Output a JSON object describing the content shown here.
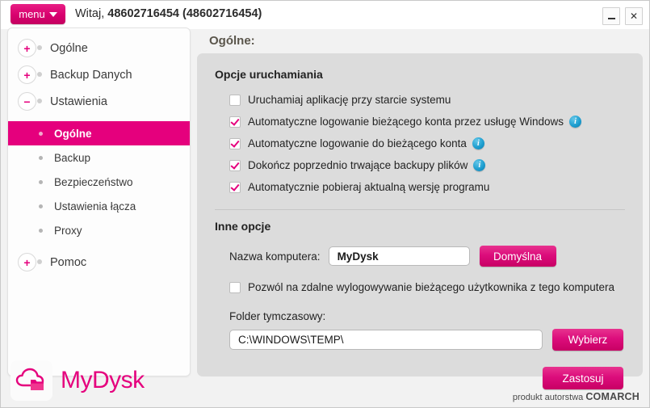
{
  "titlebar": {
    "menu_label": "menu",
    "greeting_prefix": "Witaj, ",
    "greeting_user": "48602716454 (48602716454)",
    "minimize_label": "",
    "close_label": "✕"
  },
  "sidebar": {
    "groups": [
      {
        "label": "Ogólne",
        "toggle": "+"
      },
      {
        "label": "Backup Danych",
        "toggle": "+"
      },
      {
        "label": "Ustawienia",
        "toggle": "−"
      }
    ],
    "sub_items": [
      {
        "label": "Ogólne",
        "active": true
      },
      {
        "label": "Backup",
        "active": false
      },
      {
        "label": "Bezpieczeństwo",
        "active": false
      },
      {
        "label": "Ustawienia łącza",
        "active": false
      },
      {
        "label": "Proxy",
        "active": false
      }
    ],
    "last_group": {
      "label": "Pomoc",
      "toggle": "+"
    }
  },
  "logo": {
    "text": "MyDysk"
  },
  "content": {
    "title": "Ogólne:",
    "startup_section": {
      "heading": "Opcje uruchamiania",
      "options": [
        {
          "label": "Uruchamiaj aplikację przy starcie systemu",
          "checked": false,
          "info": false
        },
        {
          "label": "Automatyczne logowanie bieżącego konta przez usługę Windows",
          "checked": true,
          "info": true
        },
        {
          "label": "Automatyczne logowanie do bieżącego konta",
          "checked": true,
          "info": true
        },
        {
          "label": "Dokończ poprzednio trwające backupy plików",
          "checked": true,
          "info": true
        },
        {
          "label": "Automatycznie pobieraj aktualną wersję programu",
          "checked": true,
          "info": false
        }
      ]
    },
    "other_section": {
      "heading": "Inne opcje",
      "computer_name_label": "Nazwa komputera:",
      "computer_name_value": "MyDysk",
      "default_button": "Domyślna",
      "remote_logout_label": "Pozwól na zdalne wylogowywanie bieżącego użytkownika z tego komputera",
      "remote_logout_checked": false,
      "temp_folder_label": "Folder tymczasowy:",
      "temp_folder_value": "C:\\WINDOWS\\TEMP\\",
      "browse_button": "Wybierz",
      "apply_button": "Zastosuj"
    }
  },
  "footer": {
    "credit_prefix": "produkt autorstwa ",
    "credit_brand": "COMARCH"
  },
  "colors": {
    "accent": "#e5007d",
    "info": "#1f9fd0",
    "panel": "#dcdcdc"
  }
}
